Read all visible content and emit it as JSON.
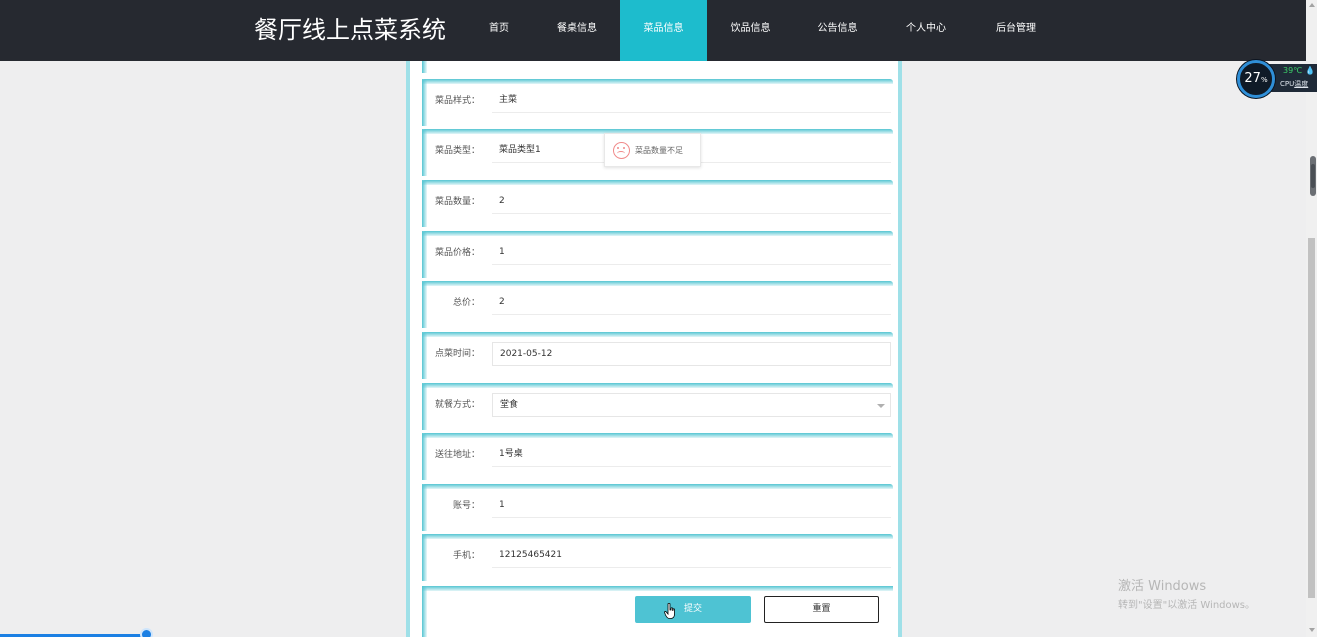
{
  "header": {
    "brand": "餐厅线上点菜系统",
    "nav": [
      {
        "label": "首页",
        "active": false
      },
      {
        "label": "餐桌信息",
        "active": false
      },
      {
        "label": "菜品信息",
        "active": true
      },
      {
        "label": "饮品信息",
        "active": false
      },
      {
        "label": "公告信息",
        "active": false
      },
      {
        "label": "个人中心",
        "active": false
      },
      {
        "label": "后台管理",
        "active": false
      }
    ]
  },
  "form": {
    "fields": [
      {
        "label": "菜品样式：",
        "value": "主菜",
        "kind": "text"
      },
      {
        "label": "菜品类型：",
        "value": "菜品类型1",
        "kind": "text"
      },
      {
        "label": "菜品数量：",
        "value": "2",
        "kind": "text"
      },
      {
        "label": "菜品价格：",
        "value": "1",
        "kind": "text"
      },
      {
        "label": "总价：",
        "value": "2",
        "kind": "text"
      },
      {
        "label": "点菜时间：",
        "value": "2021-05-12",
        "kind": "date"
      },
      {
        "label": "就餐方式：",
        "value": "堂食",
        "kind": "select"
      },
      {
        "label": "送往地址：",
        "value": "1号桌",
        "kind": "text"
      },
      {
        "label": "账号：",
        "value": "1",
        "kind": "text"
      },
      {
        "label": "手机：",
        "value": "12125465421",
        "kind": "text"
      }
    ],
    "submit_label": "提交",
    "reset_label": "重置"
  },
  "toast": {
    "message": "菜品数量不足",
    "icon": "sad-face-icon"
  },
  "cpu_widget": {
    "usage": "27",
    "usage_unit": "%",
    "temp": "39℃",
    "label_prefix": "CPU",
    "label_suffix": "温度"
  },
  "watermark": {
    "line1": "激活 Windows",
    "line2": "转到\"设置\"以激活 Windows。"
  },
  "bottom_progress": {
    "fraction": 0.11
  },
  "colors": {
    "header_bg": "#262930",
    "accent": "#1dbccd",
    "submit_bg": "#4ec3d3"
  }
}
